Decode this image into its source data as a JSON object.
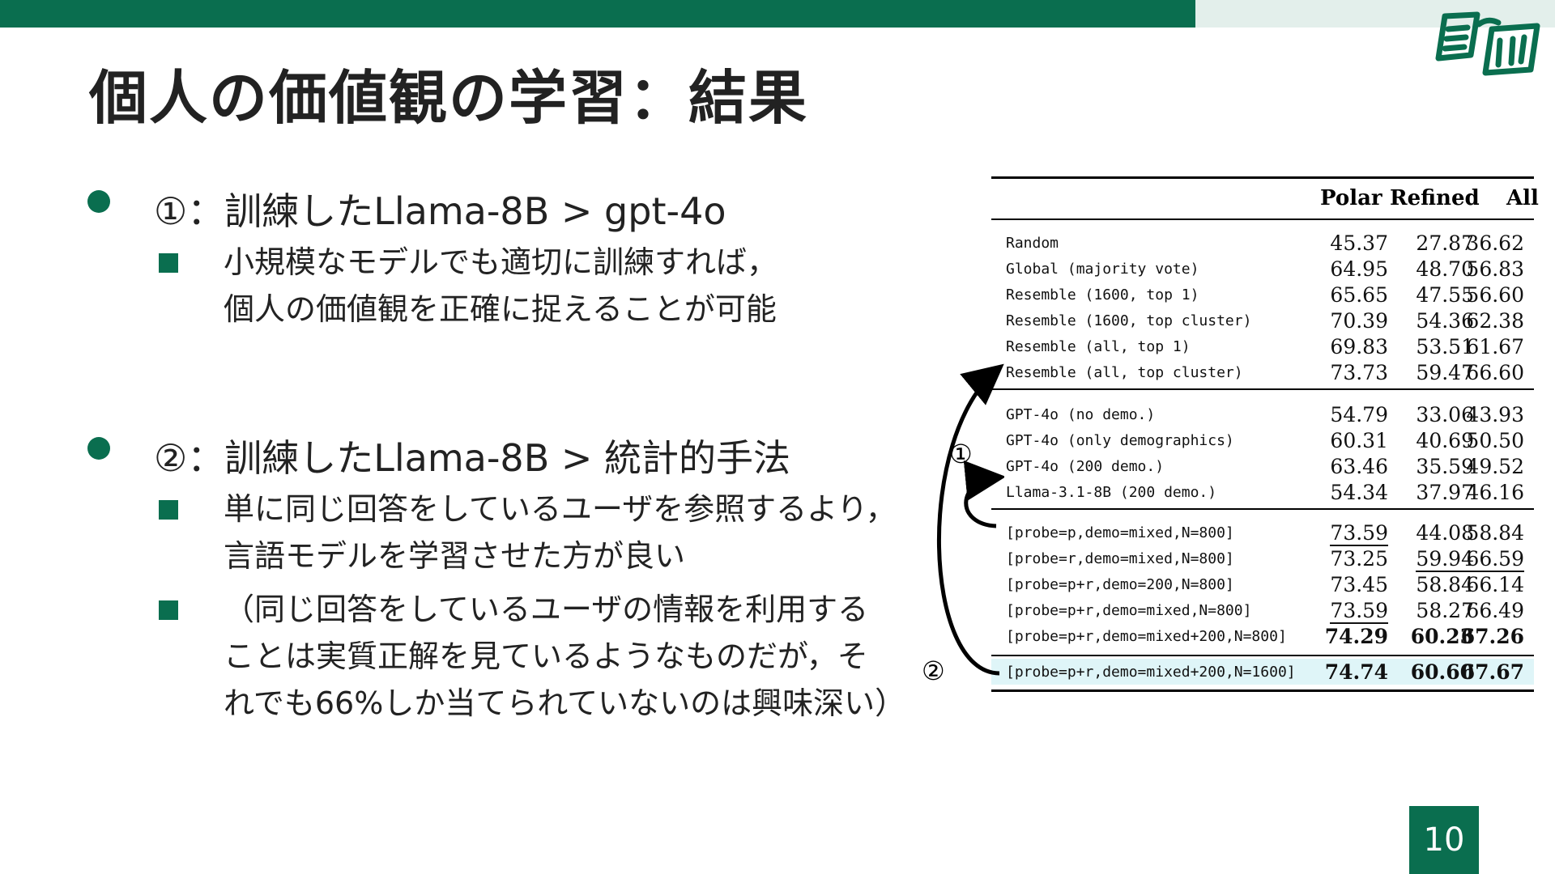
{
  "title": "個人の価値観の学習：結果",
  "bullets": [
    {
      "text": "①：訓練したLlama-8B > gpt-4o",
      "subs": [
        {
          "lines": [
            "小規模なモデルでも適切に訓練すれば，",
            "個人の価値観を正確に捉えることが可能"
          ]
        }
      ]
    },
    {
      "text": "②：訓練したLlama-8B > 統計的手法",
      "subs": [
        {
          "lines": [
            "単に同じ回答をしているユーザを参照するより，",
            "言語モデルを学習させた方が良い"
          ]
        },
        {
          "lines": [
            "（同じ回答をしているユーザの情報を利用する",
            "ことは実質正解を見ているようなものだが，そ",
            "れでも66%しか当てられていないのは興味深い）"
          ]
        }
      ]
    }
  ],
  "table": {
    "headers": [
      "Polar",
      "Refined",
      "All"
    ],
    "rows": [
      {
        "method": "Random",
        "polar": "45.37",
        "refined": "27.87",
        "all": "36.62"
      },
      {
        "method": "Global (majority vote)",
        "polar": "64.95",
        "refined": "48.70",
        "all": "56.83"
      },
      {
        "method": "Resemble (1600, top 1)",
        "polar": "65.65",
        "refined": "47.55",
        "all": "56.60"
      },
      {
        "method": "Resemble (1600, top cluster)",
        "polar": "70.39",
        "refined": "54.36",
        "all": "62.38"
      },
      {
        "method": "Resemble (all, top 1)",
        "polar": "69.83",
        "refined": "53.51",
        "all": "61.67"
      },
      {
        "method": "Resemble (all, top cluster)",
        "polar": "73.73",
        "refined": "59.47",
        "all": "66.60"
      },
      {
        "method": "GPT-4o (no demo.)",
        "polar": "54.79",
        "refined": "33.06",
        "all": "43.93"
      },
      {
        "method": "GPT-4o (only demographics)",
        "polar": "60.31",
        "refined": "40.69",
        "all": "50.50"
      },
      {
        "method": "GPT-4o (200 demo.)",
        "polar": "63.46",
        "refined": "35.59",
        "all": "49.52"
      },
      {
        "method": "Llama-3.1-8B (200 demo.)",
        "polar": "54.34",
        "refined": "37.97",
        "all": "46.16"
      },
      {
        "method": "[probe=p,demo=mixed,N=800]",
        "polar": "73.59",
        "refined": "44.08",
        "all": "58.84"
      },
      {
        "method": "[probe=r,demo=mixed,N=800]",
        "polar": "73.25",
        "refined": "59.94",
        "all": "66.59"
      },
      {
        "method": "[probe=p+r,demo=200,N=800]",
        "polar": "73.45",
        "refined": "58.84",
        "all": "66.14"
      },
      {
        "method": "[probe=p+r,demo=mixed,N=800]",
        "polar": "73.59",
        "refined": "58.27",
        "all": "66.49"
      },
      {
        "method": "[probe=p+r,demo=mixed+200,N=800]",
        "polar": "74.29",
        "refined": "60.23",
        "all": "67.26"
      },
      {
        "method": "[probe=p+r,demo=mixed+200,N=1600]",
        "polar": "74.74",
        "refined": "60.60",
        "all": "67.67"
      }
    ]
  },
  "markers": {
    "one": "①",
    "two": "②"
  },
  "page_number": "10",
  "colors": {
    "accent": "#0a6e4f",
    "highlight": "#dff5f8"
  }
}
